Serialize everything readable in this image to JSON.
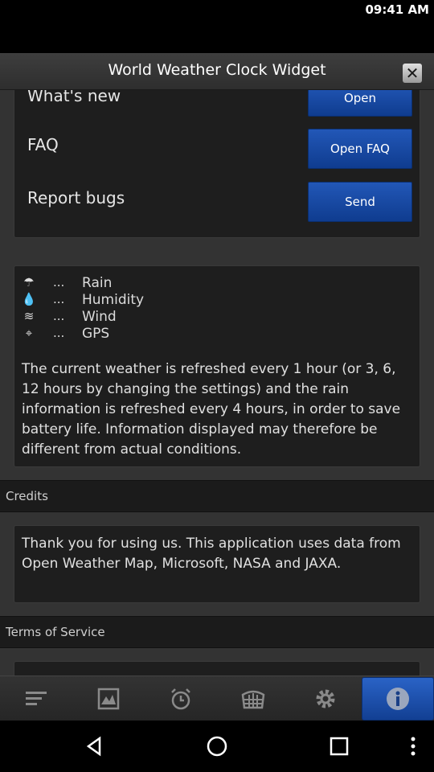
{
  "status_bar": {
    "time": "09:41 AM"
  },
  "title_bar": {
    "title": "World Weather Clock Widget",
    "close_icon": "close-icon"
  },
  "help": {
    "rows": [
      {
        "label": "What's new",
        "button": "Open"
      },
      {
        "label": "FAQ",
        "button": "Open FAQ"
      },
      {
        "label": "Report bugs",
        "button": "Send"
      }
    ]
  },
  "legend": {
    "items": [
      {
        "icon": "umbrella-icon",
        "dots": "...",
        "label": "Rain"
      },
      {
        "icon": "drop-icon",
        "dots": "...",
        "label": "Humidity"
      },
      {
        "icon": "wind-icon",
        "dots": "...",
        "label": "Wind"
      },
      {
        "icon": "satellite-icon",
        "dots": "...",
        "label": "GPS"
      }
    ],
    "description": "The current weather is refreshed every 1 hour (or 3, 6, 12 hours by changing the settings) and the rain information is refreshed every 4 hours, in order to save battery life. Information displayed may therefore be different from actual conditions."
  },
  "credits": {
    "header": "Credits",
    "text": "Thank you for using us. This application uses data from Open Weather Map, Microsoft, NASA and JAXA."
  },
  "terms": {
    "header": "Terms of Service"
  },
  "tabs": [
    {
      "icon": "menu-icon",
      "active": false
    },
    {
      "icon": "map-icon",
      "active": false
    },
    {
      "icon": "alarm-clock-icon",
      "active": false
    },
    {
      "icon": "grid-icon",
      "active": false
    },
    {
      "icon": "settings-icon",
      "active": false
    },
    {
      "icon": "info-icon",
      "active": true
    }
  ],
  "colors": {
    "accent": "#1a4ca8",
    "background": "#2a2a2a",
    "card": "#1e1e1e"
  }
}
